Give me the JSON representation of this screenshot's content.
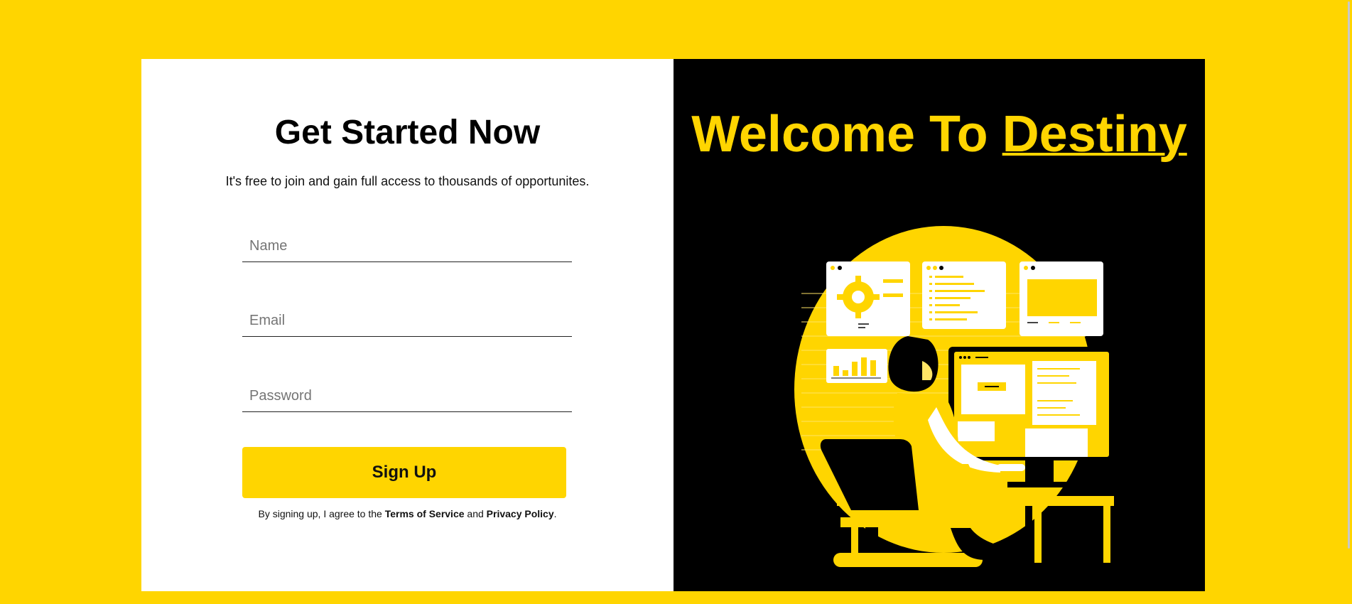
{
  "form": {
    "title": "Get Started Now",
    "subtitle": "It's free to join and gain full access to thousands of opportunites.",
    "name_placeholder": "Name",
    "email_placeholder": "Email",
    "password_placeholder": "Password",
    "submit_label": "Sign Up",
    "terms_prefix": "By signing up, I agree to the ",
    "terms_link": "Terms of Service",
    "terms_middle": " and ",
    "privacy_link": "Privacy Policy",
    "terms_suffix": "."
  },
  "hero": {
    "welcome_prefix": "Welcome To ",
    "brand": "Destiny",
    "illustration_icon": "woman-at-computer-illustration"
  },
  "colors": {
    "accent": "#FFD500",
    "hero_background": "#000000",
    "form_background": "#FFFFFF"
  }
}
